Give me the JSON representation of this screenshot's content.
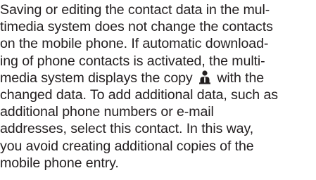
{
  "document": {
    "text_color": "#231f20",
    "icon_name": "contact-copy-person-icon",
    "lines": [
      "Saving or editing the contact data in the mul-",
      "timedia system does not change the contacts",
      "on the mobile phone. If automatic download-",
      "ing of phone contacts is activated, the multi-",
      "media system displays the copy",
      "with the",
      "changed data. To add additional data, such as",
      "additional phone numbers or e-mail",
      "addresses, select this contact. In this way,",
      "you avoid creating additional copies of the",
      "mobile phone entry."
    ]
  }
}
